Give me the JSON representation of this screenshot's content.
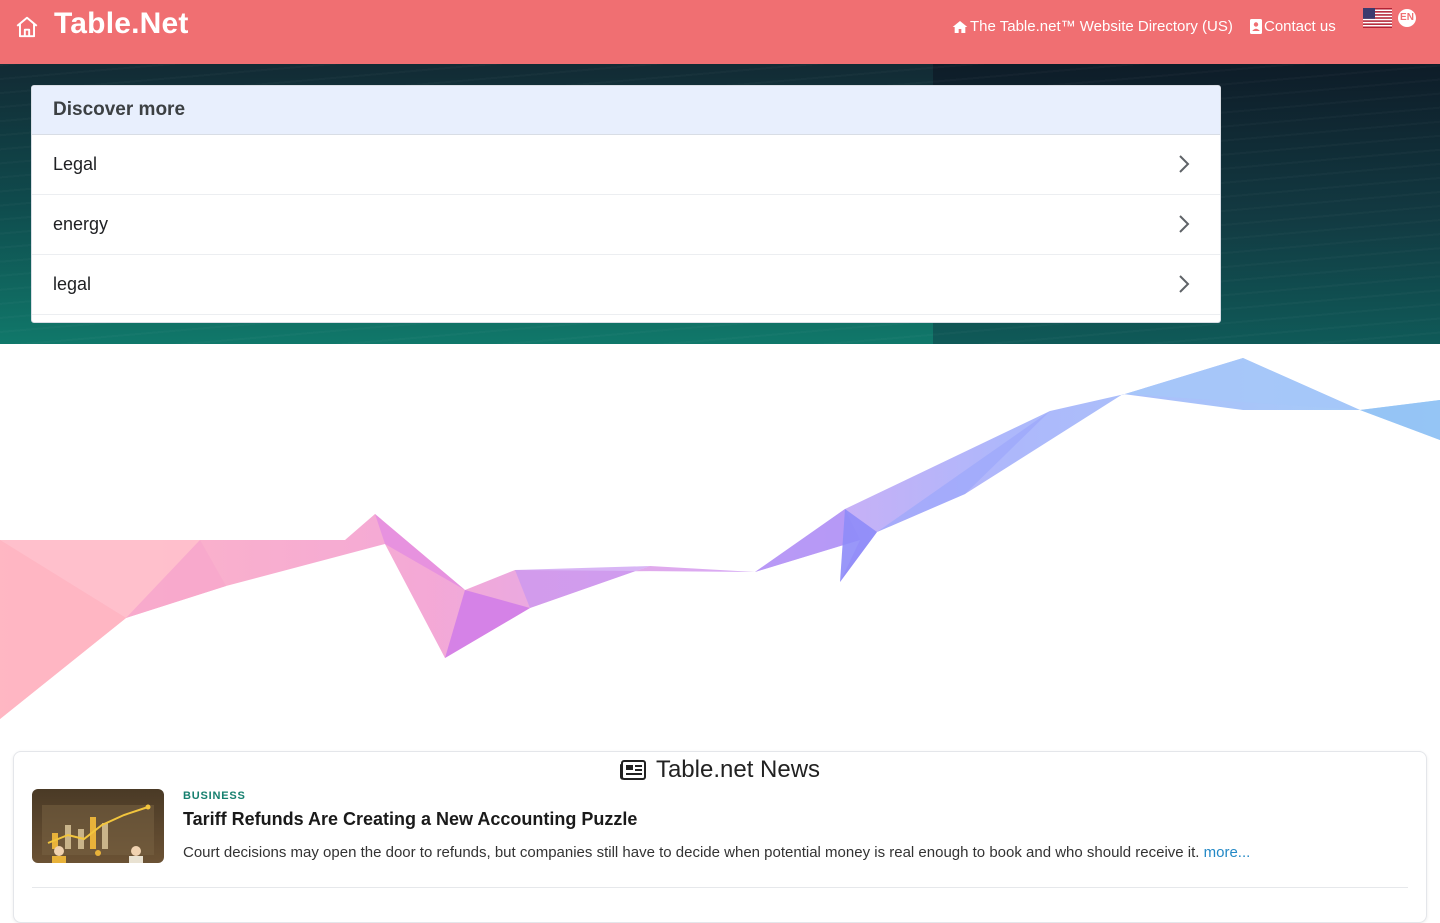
{
  "header": {
    "brand": "Table.Net",
    "nav": {
      "directory_label": "The Table.net™ Website Directory (US)",
      "contact_label": "Contact us"
    },
    "language": "EN"
  },
  "discover": {
    "title": "Discover more",
    "items": [
      {
        "label": "Legal"
      },
      {
        "label": "energy"
      },
      {
        "label": "legal"
      }
    ]
  },
  "news": {
    "section_title": "Table.net News",
    "articles": [
      {
        "category": "BUSINESS",
        "title": "Tariff Refunds Are Creating a New Accounting Puzzle",
        "summary": "Court decisions may open the door to refunds, but companies still have to decide when potential money is real enough to book and who should receive it.",
        "more_label": "more..."
      }
    ]
  },
  "colors": {
    "header_bg": "#f06f72",
    "card_header_bg": "#e8effd",
    "category": "#16806f",
    "link": "#2489c6"
  },
  "icons": {
    "home": "home-icon",
    "directory": "house-icon",
    "contact": "contact-card-icon",
    "chevron": "chevron-right-icon",
    "news": "newspaper-icon",
    "flag": "us-flag-icon"
  }
}
